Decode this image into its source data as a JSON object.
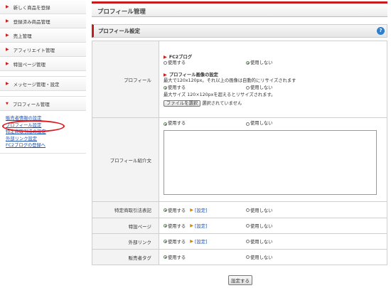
{
  "sidebar": {
    "items": [
      {
        "label": "新しく商品を登録"
      },
      {
        "label": "登録済み商品管理"
      },
      {
        "label": "売上管理"
      },
      {
        "label": "アフィリエイト管理"
      },
      {
        "label": "特設ページ管理"
      },
      {
        "label": "メッセージ管理・設定"
      },
      {
        "label": "プロフィール管理"
      }
    ],
    "sub_links": [
      {
        "label": "販売者情報の設定"
      },
      {
        "label": "プロフィール設定"
      },
      {
        "label": "特定商取引法の設定"
      },
      {
        "label": "外部リンク設定"
      },
      {
        "label": "FC2ブログの登録へ"
      }
    ]
  },
  "main": {
    "page_title": "プロフィール管理",
    "section_title": "プロフィール設定",
    "radio_use": "使用する",
    "radio_nouse": "使用しない",
    "set_link": "[設定]",
    "profile": {
      "label": "プロフィール",
      "fc2_blog": "FC2ブログ",
      "image_heading": "プロフィール画像の設定",
      "image_note": "最大で120x120px。それ以上の画像は自動的にリサイズされます",
      "resize_note": "最大サイズ 120×120pxを超えるとリサイズされます。",
      "file_button": "ファイルを選択",
      "file_status": "選択されていません"
    },
    "bio_label": "プロフィール紹介文",
    "rows": [
      {
        "label": "特定商取引法表記"
      },
      {
        "label": "特設ページ"
      },
      {
        "label": "外部リンク"
      },
      {
        "label": "販売者タグ"
      }
    ],
    "submit_label": "設定する"
  }
}
